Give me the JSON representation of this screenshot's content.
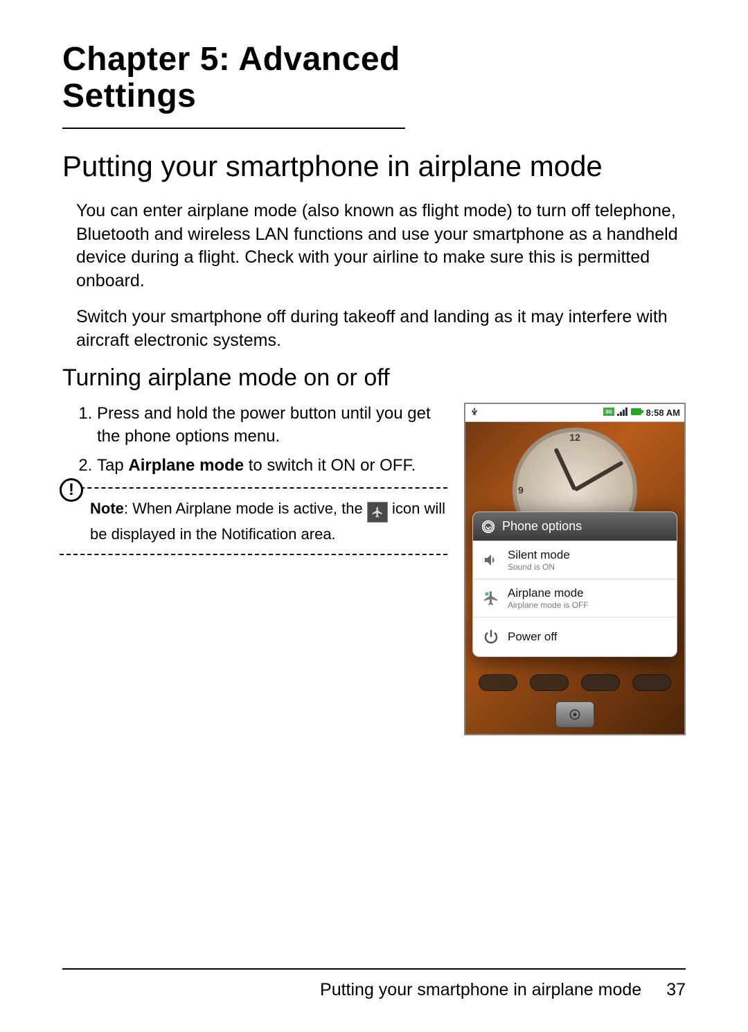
{
  "chapter_title": "Chapter 5: Advanced Settings",
  "section_title": "Putting your smartphone in airplane mode",
  "para1": "You can enter airplane mode (also known as flight mode) to turn off telephone, Bluetooth and wireless LAN functions and use your smartphone as a handheld device during a flight. Check with your airline to make sure this is permitted onboard.",
  "para2": "Switch your smartphone off during takeoff and landing as it may interfere with aircraft electronic systems.",
  "subsection_title": "Turning airplane mode on or off",
  "steps": {
    "s1": "Press and hold the power button until you get the phone options menu.",
    "s2_pre": "Tap ",
    "s2_bold": "Airplane mode",
    "s2_post": " to switch it ON or OFF."
  },
  "note": {
    "label": "Note",
    "pre": ": When Airplane mode is active, the ",
    "post": " icon will be displayed in the Notification area."
  },
  "phone": {
    "time": "8:58 AM",
    "clock_top": "12",
    "clock_left": "9",
    "dialog_title": "Phone options",
    "silent": {
      "title": "Silent mode",
      "sub": "Sound is ON"
    },
    "airplane": {
      "title": "Airplane mode",
      "sub": "Airplane mode is OFF"
    },
    "power": {
      "title": "Power off"
    }
  },
  "footer": {
    "text": "Putting your smartphone in airplane mode",
    "page": "37"
  }
}
